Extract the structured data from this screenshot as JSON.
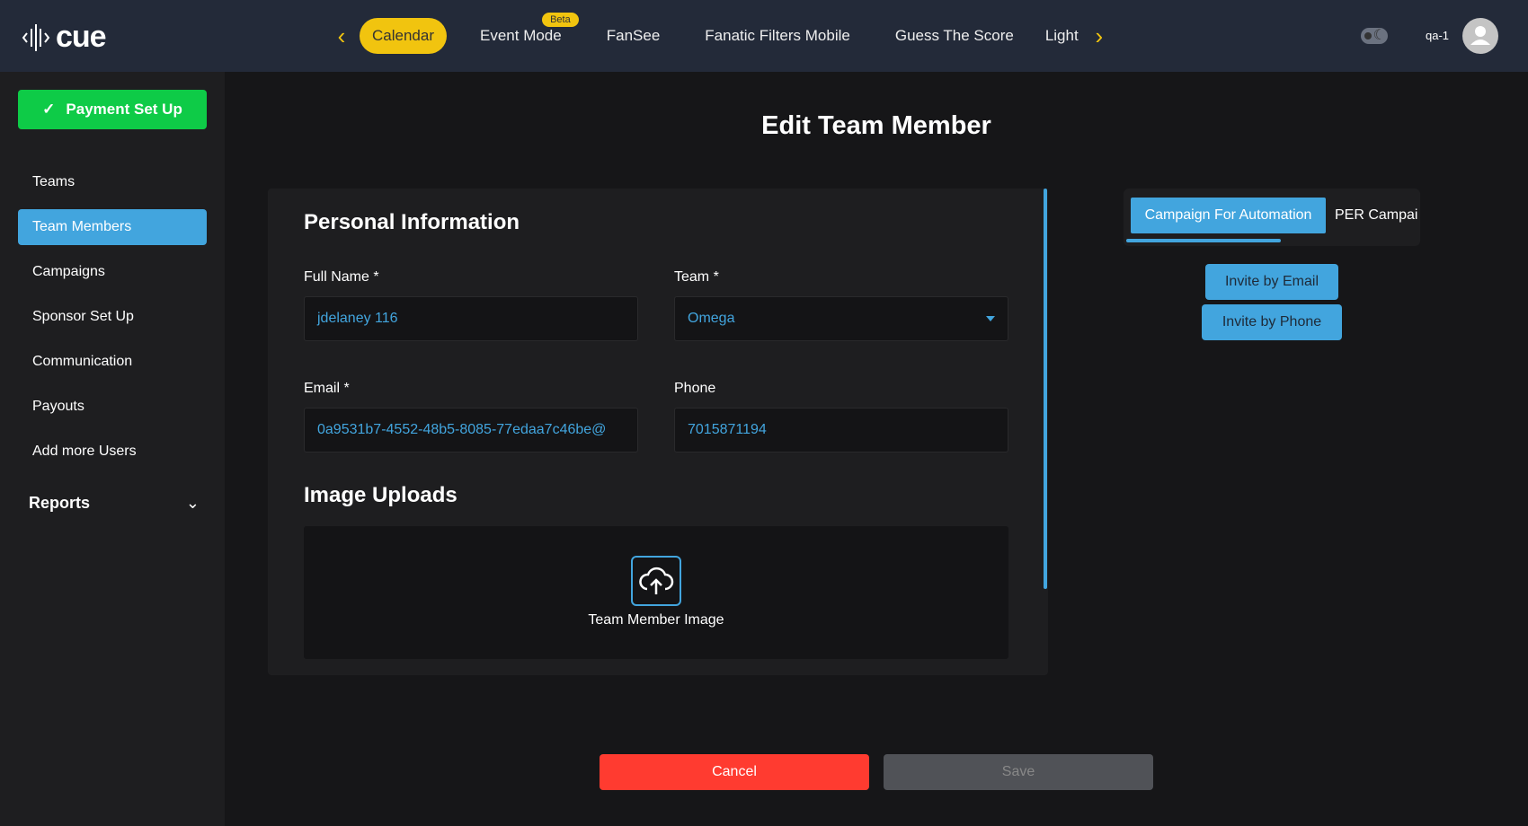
{
  "header": {
    "logo": "cue",
    "tabs": [
      {
        "label": "Calendar",
        "active": true
      },
      {
        "label": "Event Mode",
        "badge": "Beta"
      },
      {
        "label": "FanSee"
      },
      {
        "label": "Fanatic Filters Mobile"
      },
      {
        "label": "Guess The Score"
      },
      {
        "label": "Light"
      }
    ],
    "user": "qa-1"
  },
  "sidebar": {
    "payment_button": "Payment Set Up",
    "items": [
      {
        "label": "Teams"
      },
      {
        "label": "Team Members",
        "active": true
      },
      {
        "label": "Campaigns"
      },
      {
        "label": "Sponsor Set Up"
      },
      {
        "label": "Communication"
      },
      {
        "label": "Payouts"
      },
      {
        "label": "Add more Users"
      }
    ],
    "reports": "Reports"
  },
  "page": {
    "title": "Edit Team Member"
  },
  "form": {
    "personal_heading": "Personal Information",
    "full_name": {
      "label": "Full Name *",
      "value": "jdelaney 116"
    },
    "team": {
      "label": "Team *",
      "value": "Omega"
    },
    "email": {
      "label": "Email *",
      "value": "0a9531b7-4552-48b5-8085-77edaa7c46be@"
    },
    "phone": {
      "label": "Phone",
      "value": "7015871194"
    },
    "image_heading": "Image Uploads",
    "image_label": "Team Member Image"
  },
  "campaigns": {
    "tabs": [
      "Campaign For Automation",
      "PER Campai"
    ],
    "invite_email": "Invite by Email",
    "invite_phone": "Invite by Phone"
  },
  "actions": {
    "cancel": "Cancel",
    "save": "Save"
  },
  "colors": {
    "accent": "#42a5de",
    "header": "#232a39",
    "nav_active": "#f1c40f",
    "success": "#0ecb47",
    "danger": "#ff3b30"
  }
}
